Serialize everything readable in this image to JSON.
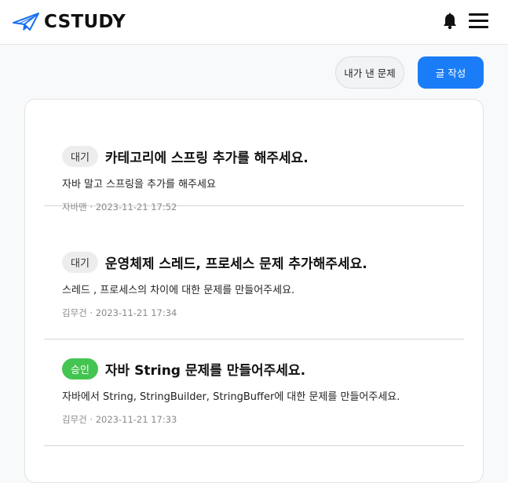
{
  "header": {
    "logo_text": "CSTUDY",
    "logo_icon": "paper-plane-icon",
    "bell_icon": "bell-icon",
    "menu_icon": "hamburger-menu-icon"
  },
  "toolbar": {
    "my_posts_label": "내가 낸 문제",
    "write_label": "글 작성"
  },
  "colors": {
    "accent": "#1a7cf7",
    "approved": "#44c451",
    "pending": "#ededed"
  },
  "posts": [
    {
      "status": "대기",
      "title": "카테고리에 스프링 추가를 해주세요.",
      "body": "자바 말고 스프링을 추가를 해주세요",
      "author": "자바맨",
      "separator": "·",
      "date": "2023-11-21 17:52"
    },
    {
      "status": "대기",
      "title": "운영체제 스레드, 프로세스 문제 추가해주세요.",
      "body": "스레드 , 프로세스의 차이에 대한 문제를 만들어주세요.",
      "author": "김무건",
      "separator": "·",
      "date": "2023-11-21 17:34"
    },
    {
      "status": "승인",
      "title": "자바 String 문제를 만들어주세요.",
      "body": "자바에서 String, StringBuilder, StringBuffer에 대한 문제를 만들어주세요.",
      "author": "김무건",
      "separator": "·",
      "date": "2023-11-21 17:33"
    }
  ]
}
